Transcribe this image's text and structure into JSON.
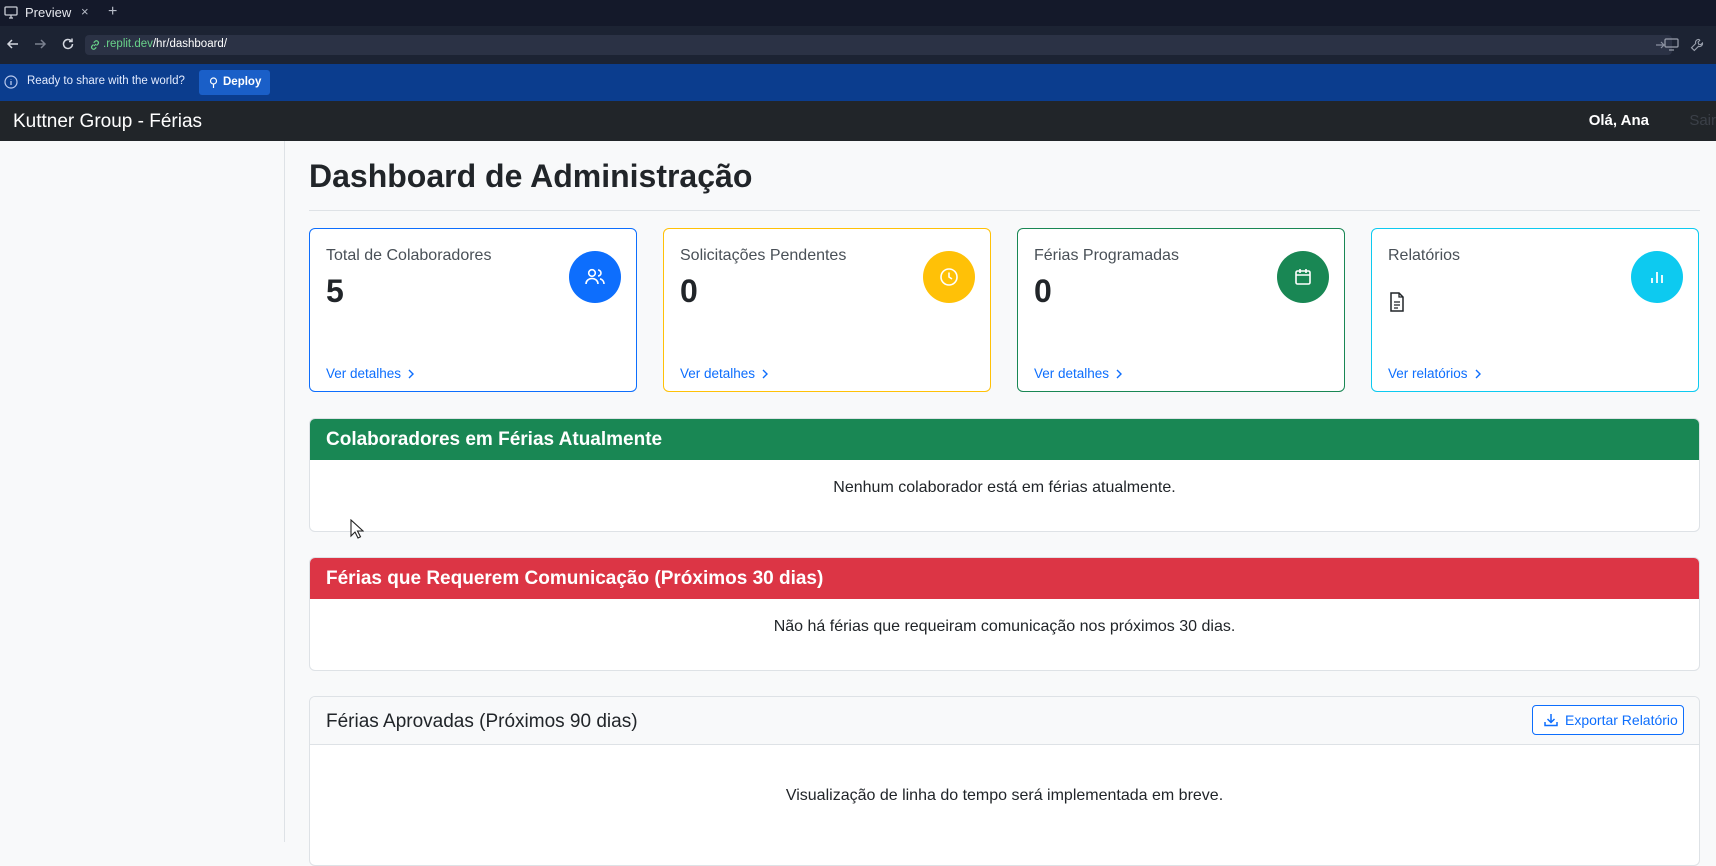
{
  "browser": {
    "tab_title": "Preview",
    "tab_close": "×",
    "new_tab": "+",
    "url_host": ".replit.dev",
    "url_path": "/hr/dashboard/"
  },
  "deploy_banner": {
    "message": "Ready to share with the world?",
    "button_label": "Deploy"
  },
  "navbar": {
    "brand": "Kuttner Group - Férias",
    "greeting": "Olá, Ana",
    "logout": "Sair"
  },
  "page": {
    "title": "Dashboard de Administração"
  },
  "cards": [
    {
      "title": "Total de Colaboradores",
      "value": "5",
      "link": "Ver detalhes",
      "icon": "users-icon",
      "color": "#0d6efd"
    },
    {
      "title": "Solicitações Pendentes",
      "value": "0",
      "link": "Ver detalhes",
      "icon": "clock-icon",
      "color": "#ffc107"
    },
    {
      "title": "Férias Programadas",
      "value": "0",
      "link": "Ver detalhes",
      "icon": "calendar-icon",
      "color": "#198754"
    },
    {
      "title": "Relatórios",
      "value": "",
      "link": "Ver relatórios",
      "icon": "bar-chart-icon",
      "color": "#0dcaf0"
    }
  ],
  "panels": {
    "on_vacation": {
      "title": "Colaboradores em Férias Atualmente",
      "empty": "Nenhum colaborador está em férias atualmente.",
      "color": "#198754"
    },
    "communication": {
      "title": "Férias que Requerem Comunicação (Próximos 30 dias)",
      "empty": "Não há férias que requeiram comunicação nos próximos 30 dias.",
      "color": "#dc3545"
    },
    "approved": {
      "title": "Férias Aprovadas (Próximos 90 dias)",
      "export_label": "Exportar Relatório",
      "empty": "Visualização de linha do tempo será implementada em breve."
    }
  }
}
